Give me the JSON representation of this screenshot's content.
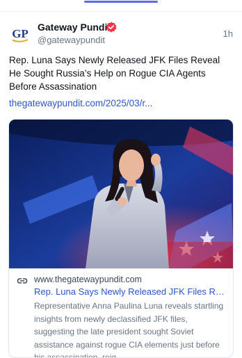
{
  "post": {
    "display_name": "Gateway Pundit",
    "handle": "@gatewaypundit",
    "time": "1h",
    "avatar_text": "GP",
    "text": "Rep. Luna Says Newly Released JFK Files Reveal He Sought Russia’s Help on Rogue CIA Agents Before Assassination",
    "link": "thegatewaypundit.com/2025/03/r..."
  },
  "card": {
    "domain": "www.thegatewaypundit.com",
    "title": "Rep. Luna Says Newly Released JFK Files Rev...",
    "description": "Representative Anna Paulina Luna reveals startling insights from newly declassified JFK files, suggesting the late president sought Soviet assistance against rogue CIA elements just before his assassination, reig..."
  },
  "colors": {
    "accent": "#5b6ee8",
    "link": "#2f55c9",
    "verified": "#f0364a",
    "avatar_brand": "#1f3d8f"
  }
}
